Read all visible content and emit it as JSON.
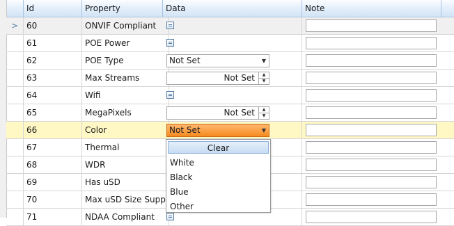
{
  "columns": {
    "id": "Id",
    "property": "Property",
    "data": "Data",
    "note": "Note"
  },
  "row_indicator": ">",
  "rows": [
    {
      "id": "60",
      "property": "ONVIF Compliant",
      "kind": "checkbox"
    },
    {
      "id": "61",
      "property": "POE Power",
      "kind": "checkbox"
    },
    {
      "id": "62",
      "property": "POE Type",
      "kind": "combo",
      "value": "Not Set"
    },
    {
      "id": "63",
      "property": "Max Streams",
      "kind": "spin",
      "value": "Not Set"
    },
    {
      "id": "64",
      "property": "Wifi",
      "kind": "checkbox"
    },
    {
      "id": "65",
      "property": "MegaPixels",
      "kind": "spin",
      "value": "Not Set"
    },
    {
      "id": "66",
      "property": "Color",
      "kind": "combo-open",
      "value": "Not Set"
    },
    {
      "id": "67",
      "property": "Thermal",
      "kind": "hidden"
    },
    {
      "id": "68",
      "property": "WDR",
      "kind": "hidden"
    },
    {
      "id": "69",
      "property": "Has uSD",
      "kind": "hidden"
    },
    {
      "id": "70",
      "property": "Max uSD Size Suppo",
      "kind": "hidden"
    },
    {
      "id": "71",
      "property": "NDAA Compliant",
      "kind": "checkbox"
    }
  ],
  "dropdown": {
    "clear_label": "Clear",
    "options": [
      "White",
      "Black",
      "Blue",
      "Other"
    ]
  },
  "colors": {
    "highlight_row": "#fff7c4",
    "active_combo": "#f68a20",
    "header": "#d3e4f6"
  }
}
